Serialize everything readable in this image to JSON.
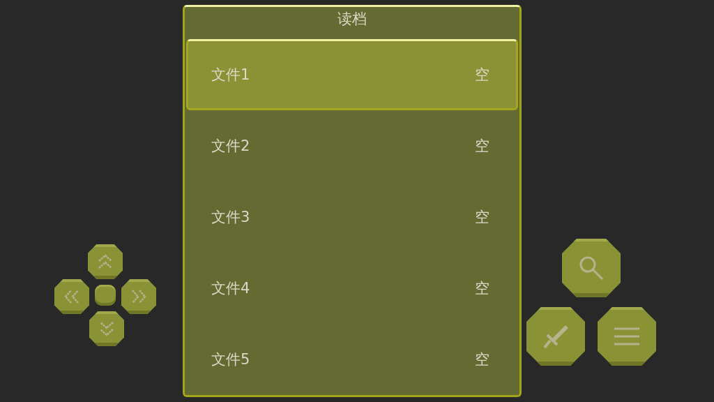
{
  "dialog": {
    "title": "读档"
  },
  "slots": [
    {
      "name": "文件1",
      "status": "空",
      "selected": true
    },
    {
      "name": "文件2",
      "status": "空",
      "selected": false
    },
    {
      "name": "文件3",
      "status": "空",
      "selected": false
    },
    {
      "name": "文件4",
      "status": "空",
      "selected": false
    },
    {
      "name": "文件5",
      "status": "空",
      "selected": false
    }
  ]
}
